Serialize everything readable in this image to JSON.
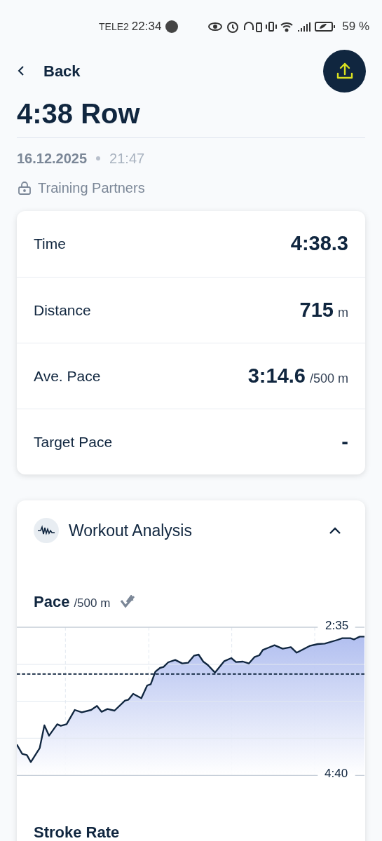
{
  "status_bar": {
    "carrier": "TELE2",
    "time": "22:34",
    "battery": "59 %"
  },
  "header": {
    "back_label": "Back"
  },
  "title": "4:38 Row",
  "meta": {
    "date": "16.12.2025",
    "time": "21:47",
    "visibility": "Training Partners"
  },
  "stats": [
    {
      "label": "Time",
      "value": "4:38.3"
    },
    {
      "label": "Distance",
      "value": "715",
      "unit": "m"
    },
    {
      "label": "Ave. Pace",
      "value": "3:14.6",
      "unit": "/500 m"
    },
    {
      "label": "Target Pace",
      "value": "-"
    }
  ],
  "analysis": {
    "title": "Workout Analysis",
    "expanded": true,
    "pace_chart": {
      "title": "Pace",
      "unit": "/500 m",
      "top_label": "2:35",
      "bottom_label": "4:40"
    },
    "next_title": "Stroke Rate"
  }
}
